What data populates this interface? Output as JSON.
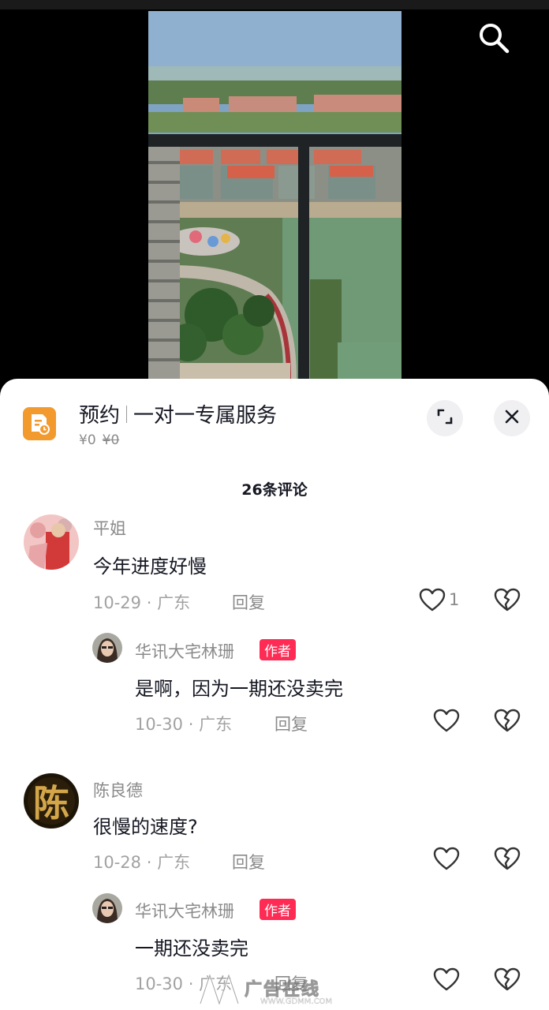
{
  "video": {
    "search_icon": "search-icon"
  },
  "promo": {
    "icon": "calendar-clock-icon",
    "title": "预约",
    "subtitle": "一对一专属服务",
    "price": "¥0",
    "original_price": "¥0",
    "expand_icon": "expand-icon",
    "close_icon": "close-icon"
  },
  "comments_header": "26条评论",
  "comments": [
    {
      "user": "平姐",
      "text": "今年进度好慢",
      "date": "10-29",
      "location": "广东",
      "reply_label": "回复",
      "likes": "1",
      "reply": {
        "user": "华讯大宅林珊",
        "badge": "作者",
        "text": "是啊，因为一期还没卖完",
        "date": "10-30",
        "location": "广东",
        "reply_label": "回复"
      }
    },
    {
      "user": "陈良德",
      "avatar_char": "陈",
      "text": "很慢的速度?",
      "date": "10-28",
      "location": "广东",
      "reply_label": "回复",
      "reply": {
        "user": "华讯大宅林珊",
        "badge": "作者",
        "text": "一期还没卖完",
        "date": "10-30",
        "location": "广东",
        "reply_label": "回复"
      }
    }
  ],
  "meta_sep": "·",
  "watermark": {
    "text": "广告在线",
    "url": "WWW.GDMM.COM"
  }
}
